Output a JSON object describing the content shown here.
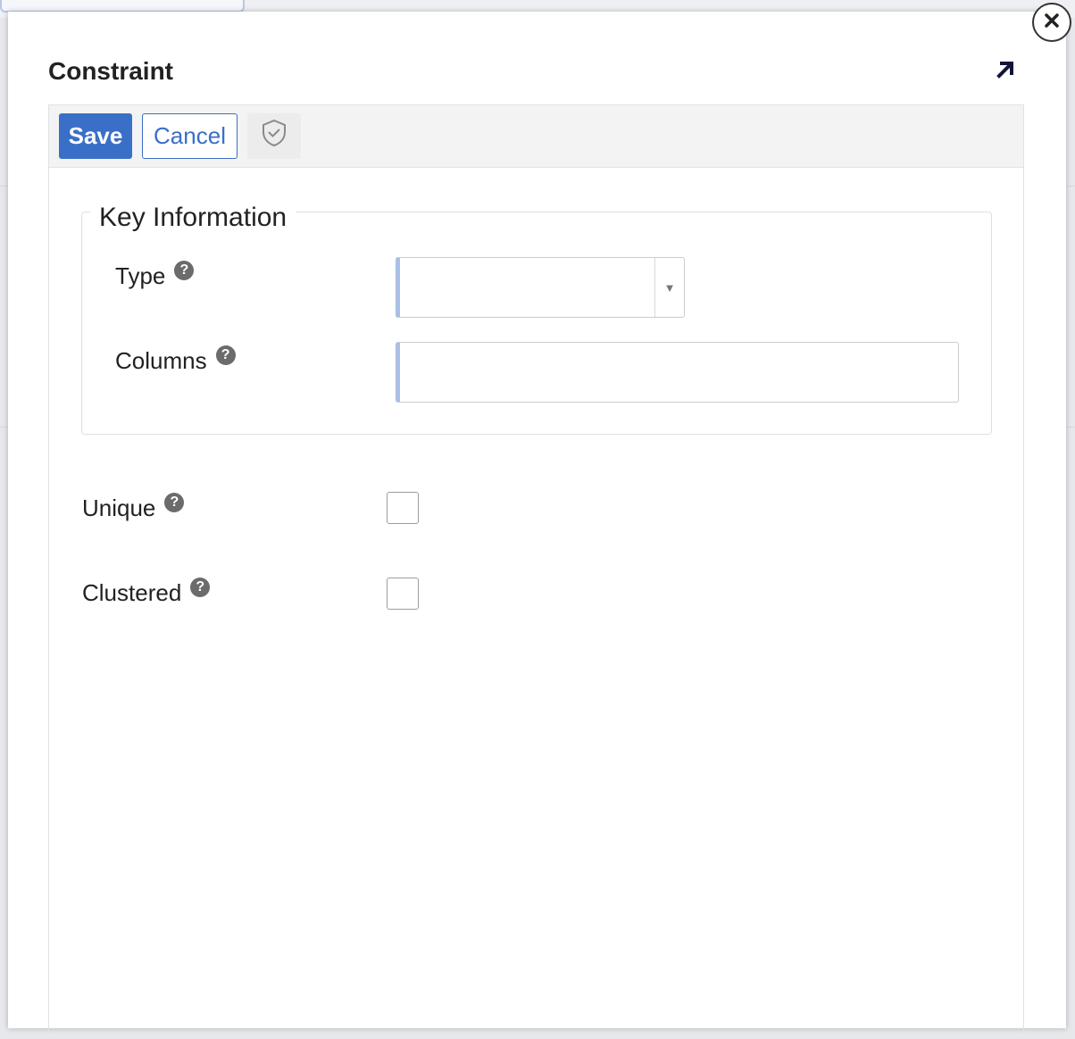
{
  "dialog": {
    "title": "Constraint"
  },
  "toolbar": {
    "save_label": "Save",
    "cancel_label": "Cancel",
    "shield_icon": "shield-check-icon"
  },
  "key_information": {
    "legend": "Key Information",
    "type": {
      "label": "Type",
      "help": "?",
      "value": ""
    },
    "columns": {
      "label": "Columns",
      "help": "?",
      "value": ""
    }
  },
  "options": {
    "unique": {
      "label": "Unique",
      "help": "?",
      "checked": false
    },
    "clustered": {
      "label": "Clustered",
      "help": "?",
      "checked": false
    }
  },
  "colors": {
    "accent": "#3a6fc7",
    "field_accent": "#a9bfe6"
  }
}
